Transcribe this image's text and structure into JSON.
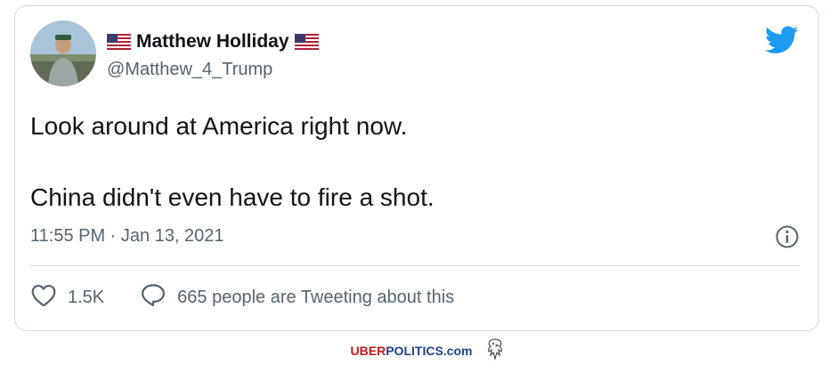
{
  "tweet": {
    "author": {
      "name": "Matthew Holliday",
      "handle": "@Matthew_4_Trump"
    },
    "text": {
      "line1": "Look around at America right now.",
      "line2": "China didn't even have to fire a shot."
    },
    "timestamp": "11:55 PM · Jan 13, 2021",
    "likes": "1.5K",
    "conversation": "665 people are Tweeting about this"
  },
  "footer": {
    "brand_part1": "UBER",
    "brand_part2": "POLITICS.com"
  },
  "icons": {
    "flag": "us-flag-icon",
    "logo": "twitter-bird-icon",
    "info": "info-icon",
    "like": "heart-icon",
    "reply": "reply-bubble-icon",
    "mascot": "eagle-icon"
  },
  "colors": {
    "twitter_blue": "#1d9bf0",
    "text_primary": "#0f1419",
    "text_secondary": "#536471",
    "border": "#cfd9de",
    "brand_red": "#c4161c",
    "brand_blue": "#1f3f8f"
  }
}
